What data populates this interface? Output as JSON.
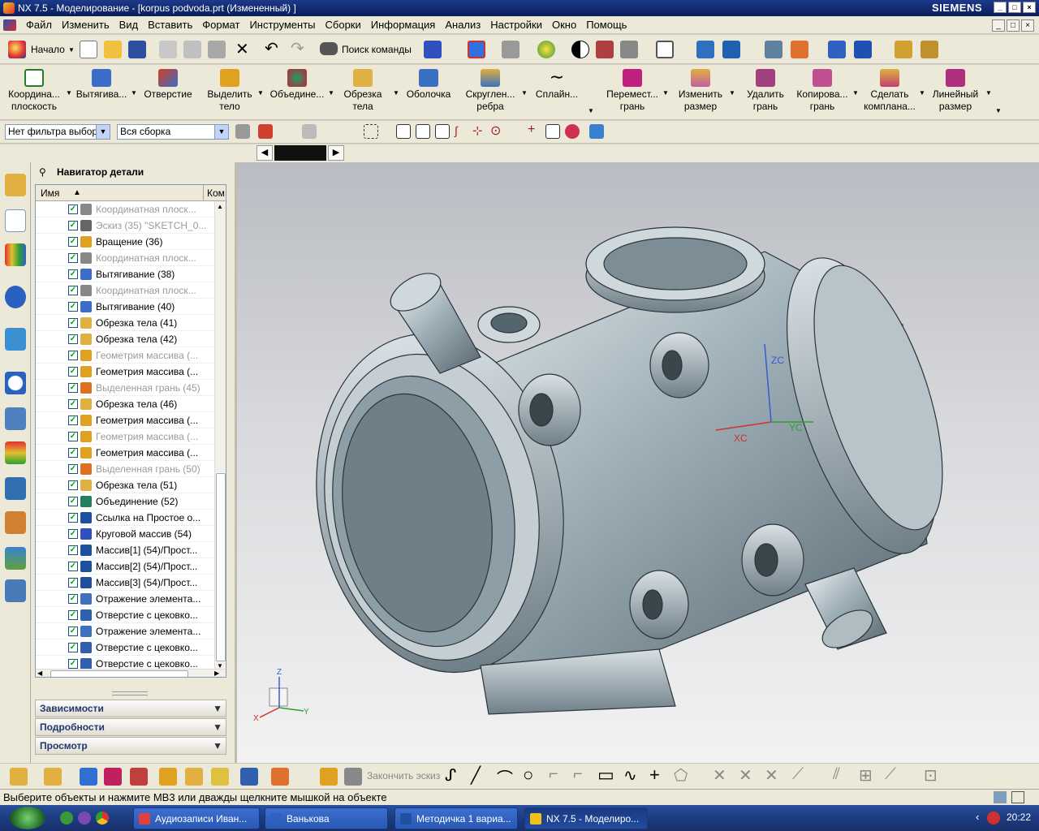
{
  "window": {
    "title": "NX 7.5 - Моделирование - [korpus podvoda.prt (Измененный) ]",
    "brand": "SIEMENS"
  },
  "menu": [
    "Файл",
    "Изменить",
    "Вид",
    "Вставить",
    "Формат",
    "Инструменты",
    "Сборки",
    "Информация",
    "Анализ",
    "Настройки",
    "Окно",
    "Помощь"
  ],
  "toolbar1": {
    "start_label": "Начало",
    "search_label": "Поиск команды"
  },
  "toolbar2": [
    {
      "label": "Координа...\nплоскость",
      "icon": "datum-plane-icon",
      "color": "#2c7a2c"
    },
    {
      "label": "Вытягива...",
      "icon": "extrude-icon",
      "color": "#3a6ec8"
    },
    {
      "label": "Отверстие",
      "icon": "hole-icon",
      "color": "#d04020"
    },
    {
      "label": "Выделить\nтело",
      "icon": "extract-body-icon",
      "color": "#e0a020"
    },
    {
      "label": "Объедине...",
      "icon": "unite-icon",
      "color": "#c02040"
    },
    {
      "label": "Обрезка\nтела",
      "icon": "trim-body-icon",
      "color": "#e0b040"
    },
    {
      "label": "Оболочка",
      "icon": "shell-icon",
      "color": "#3a70c0"
    },
    {
      "label": "Скруглен...\nребра",
      "icon": "edge-blend-icon",
      "color": "#3a70c0"
    },
    {
      "label": "Сплайн...",
      "icon": "spline-icon",
      "color": "#202020"
    },
    {
      "label": "Перемест...\nгрань",
      "icon": "move-face-icon",
      "color": "#c02080"
    },
    {
      "label": "Изменить\nразмер",
      "icon": "resize-face-icon",
      "color": "#c060a0"
    },
    {
      "label": "Удалить\nгрань",
      "icon": "delete-face-icon",
      "color": "#a04080"
    },
    {
      "label": "Копирова...\nгрань",
      "icon": "copy-face-icon",
      "color": "#c05090"
    },
    {
      "label": "Сделать\nкомплана...",
      "icon": "make-coplanar-icon",
      "color": "#c04070"
    },
    {
      "label": "Линейный\nразмер",
      "icon": "linear-dimension-icon",
      "color": "#b03080"
    }
  ],
  "selection_bar": {
    "filter_value": "Нет фильтра выбор",
    "scope_value": "Вся сборка"
  },
  "navigator": {
    "title": "Навигатор детали",
    "col_name": "Имя",
    "col_comment": "Ком",
    "rows": [
      {
        "text": "Координатная плоск...",
        "dim": true,
        "icon": "datum-plane-icon",
        "color": "#888"
      },
      {
        "text": "Эскиз (35) \"SKETCH_0...",
        "dim": true,
        "icon": "sketch-icon",
        "color": "#666"
      },
      {
        "text": "Вращение (36)",
        "dim": false,
        "icon": "revolve-icon",
        "color": "#e0a020"
      },
      {
        "text": "Координатная плоск...",
        "dim": true,
        "icon": "datum-plane-icon",
        "color": "#888"
      },
      {
        "text": "Вытягивание (38)",
        "dim": false,
        "icon": "extrude-icon",
        "color": "#3a6ec8"
      },
      {
        "text": "Координатная плоск...",
        "dim": true,
        "icon": "datum-plane-icon",
        "color": "#888"
      },
      {
        "text": "Вытягивание (40)",
        "dim": false,
        "icon": "extrude-icon",
        "color": "#3a6ec8"
      },
      {
        "text": "Обрезка тела (41)",
        "dim": false,
        "icon": "trim-body-icon",
        "color": "#e0b040"
      },
      {
        "text": "Обрезка тела (42)",
        "dim": false,
        "icon": "trim-body-icon",
        "color": "#e0b040"
      },
      {
        "text": "Геометрия массива (...",
        "dim": true,
        "icon": "pattern-geometry-icon",
        "color": "#e0a020"
      },
      {
        "text": "Геометрия массива (...",
        "dim": false,
        "icon": "pattern-geometry-icon",
        "color": "#e0a020"
      },
      {
        "text": "Выделенная грань (45)",
        "dim": true,
        "icon": "extract-face-icon",
        "color": "#e07020"
      },
      {
        "text": "Обрезка тела (46)",
        "dim": false,
        "icon": "trim-body-icon",
        "color": "#e0b040"
      },
      {
        "text": "Геометрия массива (...",
        "dim": false,
        "icon": "pattern-geometry-icon",
        "color": "#e0a020"
      },
      {
        "text": "Геометрия массива (...",
        "dim": true,
        "icon": "pattern-geometry-icon",
        "color": "#e0a020"
      },
      {
        "text": "Геометрия массива (...",
        "dim": false,
        "icon": "pattern-geometry-icon",
        "color": "#e0a020"
      },
      {
        "text": "Выделенная грань (50)",
        "dim": true,
        "icon": "extract-face-icon",
        "color": "#e07020"
      },
      {
        "text": "Обрезка тела (51)",
        "dim": false,
        "icon": "trim-body-icon",
        "color": "#e0b040"
      },
      {
        "text": "Объединение (52)",
        "dim": false,
        "icon": "unite-icon",
        "color": "#208060"
      },
      {
        "text": "Ссылка на Простое о...",
        "dim": false,
        "icon": "reference-icon",
        "color": "#2050a0"
      },
      {
        "text": "Круговой массив (54)",
        "dim": false,
        "icon": "circular-array-icon",
        "color": "#3050c0"
      },
      {
        "text": "Массив[1] (54)/Прост...",
        "dim": false,
        "icon": "instance-icon",
        "color": "#2050a0"
      },
      {
        "text": "Массив[2] (54)/Прост...",
        "dim": false,
        "icon": "instance-icon",
        "color": "#2050a0"
      },
      {
        "text": "Массив[3] (54)/Прост...",
        "dim": false,
        "icon": "instance-icon",
        "color": "#2050a0"
      },
      {
        "text": "Отражение элемента...",
        "dim": false,
        "icon": "mirror-feature-icon",
        "color": "#4070c0"
      },
      {
        "text": "Отверстие с цековко...",
        "dim": false,
        "icon": "counterbore-hole-icon",
        "color": "#3060b0"
      },
      {
        "text": "Отражение элемента...",
        "dim": false,
        "icon": "mirror-feature-icon",
        "color": "#4070c0"
      },
      {
        "text": "Отверстие с цековко...",
        "dim": false,
        "icon": "counterbore-hole-icon",
        "color": "#3060b0"
      },
      {
        "text": "Отверстие с цековко...",
        "dim": false,
        "icon": "counterbore-hole-icon",
        "color": "#3060b0"
      }
    ],
    "panels": [
      "Зависимости",
      "Подробности",
      "Просмотр"
    ]
  },
  "viewport": {
    "wcs_labels": {
      "zc": "ZC",
      "xc": "XC",
      "yc": "YC"
    },
    "triad_labels": {
      "z": "Z",
      "x": "X",
      "y": "Y"
    }
  },
  "bottom_toolbar": {
    "finish_sketch_label": "Закончить эскиз"
  },
  "status": {
    "message": "Выберите объекты и нажмите MB3 или дважды щелкните мышкой на объекте"
  },
  "taskbar": {
    "tasks": [
      {
        "label": "Аудиозаписи Иван...",
        "color": "#e04040"
      },
      {
        "label": "Ванькова",
        "color": "#3060c0"
      },
      {
        "label": "Методичка 1 вариа...",
        "color": "#2050a0"
      },
      {
        "label": "NX 7.5 - Моделиро...",
        "color": "#f0c020",
        "active": true
      }
    ],
    "clock": "20:22"
  }
}
